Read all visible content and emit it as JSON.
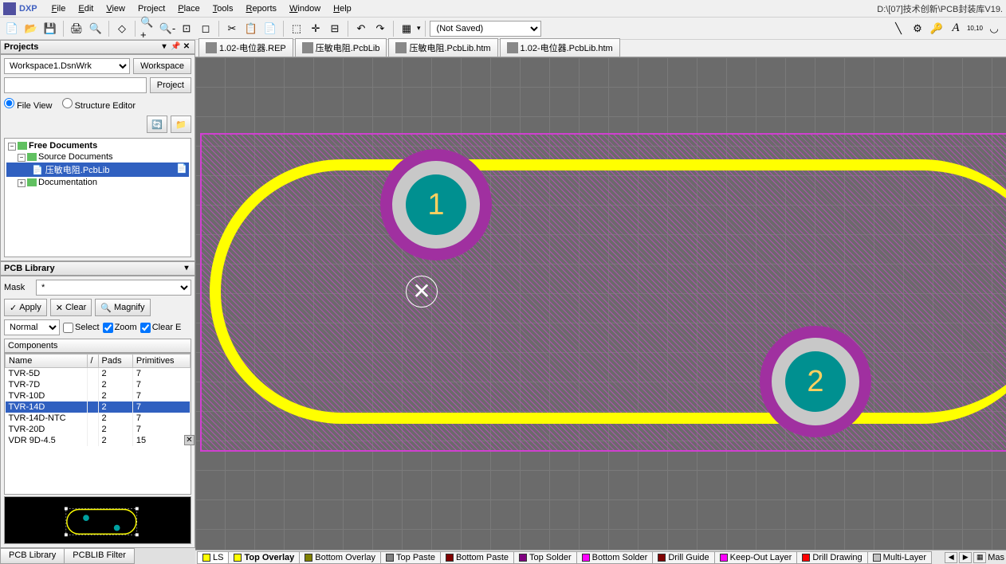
{
  "app": {
    "title": "DXP",
    "filepath": "D:\\[07]技术创新\\PCB封装库V19."
  },
  "menu": {
    "file": "File",
    "edit": "Edit",
    "view": "View",
    "project": "Project",
    "place": "Place",
    "tools": "Tools",
    "reports": "Reports",
    "window": "Window",
    "help": "Help"
  },
  "toolbar": {
    "saved_combo": "(Not Saved)"
  },
  "projects": {
    "panel_title": "Projects",
    "workspace": "Workspace1.DsnWrk",
    "workspace_btn": "Workspace",
    "project_btn": "Project",
    "file_view": "File View",
    "structure_editor": "Structure Editor",
    "tree": {
      "root": "Free Documents",
      "src": "Source Documents",
      "file": "压敏电阻.PcbLib",
      "doc": "Documentation"
    }
  },
  "pcblib": {
    "panel_title": "PCB Library",
    "mask_lbl": "Mask",
    "mask_val": "*",
    "apply": "Apply",
    "clear": "Clear",
    "magnify": "Magnify",
    "normal": "Normal",
    "select_chk": "Select",
    "zoom_chk": "Zoom",
    "clear_chk": "Clear E",
    "components_hdr": "Components",
    "cols": {
      "name": "Name",
      "pads": "Pads",
      "primitives": "Primitives"
    },
    "rows": [
      {
        "name": "TVR-5D",
        "pads": "2",
        "prim": "7"
      },
      {
        "name": "TVR-7D",
        "pads": "2",
        "prim": "7"
      },
      {
        "name": "TVR-10D",
        "pads": "2",
        "prim": "7"
      },
      {
        "name": "TVR-14D",
        "pads": "2",
        "prim": "7"
      },
      {
        "name": "TVR-14D-NTC",
        "pads": "2",
        "prim": "7"
      },
      {
        "name": "TVR-20D",
        "pads": "2",
        "prim": "7"
      },
      {
        "name": "VDR 9D-4.5",
        "pads": "2",
        "prim": "15"
      }
    ],
    "selected_index": 3
  },
  "lefttabs": {
    "lib": "PCB Library",
    "filter": "PCBLIB Filter"
  },
  "doctabs": [
    {
      "label": "1.02-电位器.REP"
    },
    {
      "label": "压敏电阻.PcbLib"
    },
    {
      "label": "压敏电阻.PcbLib.htm"
    },
    {
      "label": "1.02-电位器.PcbLib.htm"
    }
  ],
  "pads": {
    "p1": "1",
    "p2": "2"
  },
  "layers": [
    {
      "name": "LS",
      "color": "#ffff00",
      "active": true
    },
    {
      "name": "Top Overlay",
      "color": "#ffff00",
      "bold": true
    },
    {
      "name": "Bottom Overlay",
      "color": "#808000"
    },
    {
      "name": "Top Paste",
      "color": "#808080"
    },
    {
      "name": "Bottom Paste",
      "color": "#800000"
    },
    {
      "name": "Top Solder",
      "color": "#800080"
    },
    {
      "name": "Bottom Solder",
      "color": "#ff00ff"
    },
    {
      "name": "Drill Guide",
      "color": "#800000"
    },
    {
      "name": "Keep-Out Layer",
      "color": "#ff00ff"
    },
    {
      "name": "Drill Drawing",
      "color": "#ff0000"
    },
    {
      "name": "Multi-Layer",
      "color": "#c0c0c0"
    }
  ],
  "status_mask": "Mas"
}
